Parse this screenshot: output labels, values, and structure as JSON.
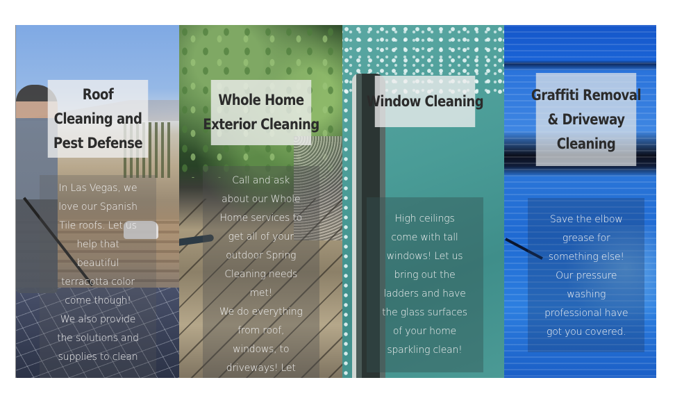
{
  "panels": [
    {
      "id": "roof",
      "image": "roof-cleaning-photo",
      "title_lines": [
        "Roof",
        "Cleaning and",
        "Pest Defense"
      ],
      "body_lines": [
        "In Las Vegas, we",
        "love our Spanish",
        "Tile roofs. Let us",
        "help that",
        "beautiful",
        "terracotta color",
        "come though!",
        "We also provide",
        "the solutions and",
        "supplies to clean"
      ]
    },
    {
      "id": "whole-home",
      "image": "exterior-deck-cleaning-photo",
      "title_lines": [
        "Whole Home",
        "Exterior Cleaning"
      ],
      "body_lines": [
        "Call and ask",
        "about our Whole",
        "Home services to",
        "get all of your",
        "outdoor Spring",
        "Cleaning needs",
        "met!",
        "We do everything",
        "from roof,",
        "windows, to",
        "driveways! Let"
      ]
    },
    {
      "id": "window",
      "image": "window-squeegee-photo",
      "title_lines": [
        "Window Cleaning"
      ],
      "body_lines": [
        "High ceilings",
        "come with tall",
        "windows! Let us",
        "bring out the",
        "ladders and have",
        "the glass surfaces",
        "of your home",
        "sparkling clean!"
      ]
    },
    {
      "id": "graffiti",
      "image": "pressure-washing-garage-door-photo",
      "title_lines": [
        "Graffiti Removal",
        "& Driveway",
        "Cleaning"
      ],
      "body_lines": [
        "Save the elbow",
        "grease for",
        "something else!",
        "Our pressure",
        "washing",
        "professional have",
        "got you covered."
      ]
    }
  ]
}
